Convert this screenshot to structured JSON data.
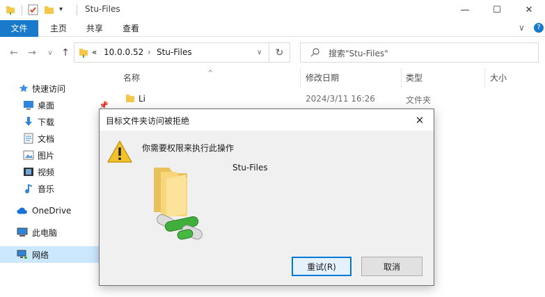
{
  "window": {
    "title": "Stu-Files",
    "minimize": "—",
    "maximize": "☐",
    "close": "✕"
  },
  "ribbon": {
    "tabs": [
      "文件",
      "主页",
      "共享",
      "查看"
    ],
    "collapse_glyph": "∨",
    "help_glyph": "?"
  },
  "nav": {
    "back": "←",
    "forward": "→",
    "recent": "∨",
    "up": "↑",
    "address_prefix": "«",
    "path": [
      "10.0.0.52",
      "Stu-Files"
    ],
    "path_sep": "›",
    "address_dropdown": "∨",
    "refresh": "↻",
    "search_placeholder": "搜索\"Stu-Files\""
  },
  "sidebar": {
    "items": [
      {
        "label": "快速访问",
        "icon": "star-icon"
      },
      {
        "label": "桌面",
        "icon": "desktop-icon"
      },
      {
        "label": "下载",
        "icon": "download-icon"
      },
      {
        "label": "文档",
        "icon": "document-icon"
      },
      {
        "label": "图片",
        "icon": "picture-icon"
      },
      {
        "label": "视频",
        "icon": "video-icon"
      },
      {
        "label": "音乐",
        "icon": "music-icon"
      },
      {
        "label": "OneDrive",
        "icon": "cloud-icon"
      },
      {
        "label": "此电脑",
        "icon": "computer-icon"
      },
      {
        "label": "网络",
        "icon": "network-icon"
      }
    ],
    "selected_index": 9
  },
  "content": {
    "columns": [
      "名称",
      "修改日期",
      "类型",
      "大小"
    ],
    "sort_glyph": "^",
    "rows": [
      {
        "name": "Li",
        "modified": "2024/3/11 16:26",
        "type": "文件夹"
      }
    ]
  },
  "dialog": {
    "title": "目标文件夹访问被拒绝",
    "message": "你需要权限来执行此操作",
    "folder_name": "Stu-Files",
    "retry_label": "重试(R)",
    "cancel_label": "取消",
    "close_glyph": "✕",
    "warning_glyph": "!"
  },
  "colors": {
    "accent": "#1979ca",
    "selected_bg": "#cce8ff",
    "folder_yellow": "#f5c84c",
    "warning_yellow": "#f2c12e",
    "network_green": "#3fae3b"
  }
}
